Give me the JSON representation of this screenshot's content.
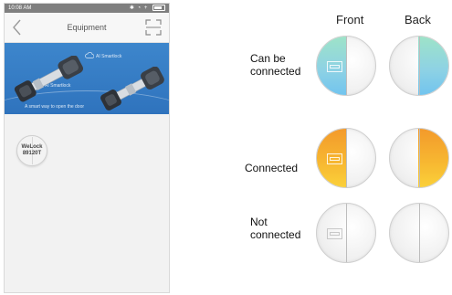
{
  "status_bar": {
    "time": "10:08 AM"
  },
  "nav": {
    "title": "Equipment"
  },
  "banner": {
    "label_top": "AI Smartlock",
    "label_middle": "AI Smartlock",
    "slogan": "A smart way to open the door"
  },
  "device": {
    "name": "WeLock\n89120T"
  },
  "legend": {
    "columns": {
      "front": "Front",
      "back": "Back"
    },
    "rows": [
      {
        "label": "Can be\nconnected",
        "color": "#8fd2e6"
      },
      {
        "label": "Connected",
        "color": "#f7b22f"
      },
      {
        "label": "Not\nconnected",
        "color": "#e6e6e6"
      }
    ]
  }
}
